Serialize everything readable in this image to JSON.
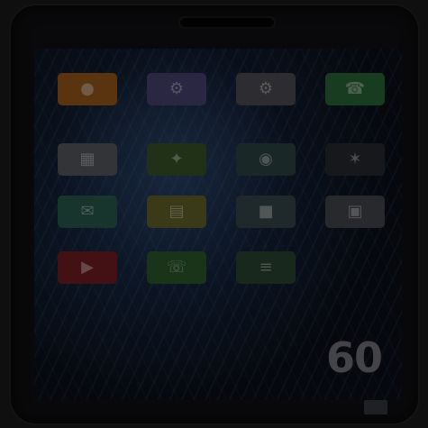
{
  "home_screen": {
    "apps": [
      {
        "row": 0,
        "col": 0,
        "label": "",
        "icon": "orange-circle-icon",
        "color": "#a4601c"
      },
      {
        "row": 0,
        "col": 1,
        "label": "",
        "icon": "settings-icon",
        "color": "#4c4778"
      },
      {
        "row": 0,
        "col": 2,
        "label": "",
        "icon": "gear-icon",
        "color": "#52525a"
      },
      {
        "row": 0,
        "col": 3,
        "label": "",
        "icon": "phone-icon",
        "color": "#2c6e3a"
      },
      {
        "row": 1,
        "col": 0,
        "label": "",
        "icon": "calendar-icon",
        "color": "#5c5f66"
      },
      {
        "row": 1,
        "col": 1,
        "label": "",
        "icon": "maps-icon",
        "color": "#3b5a2b"
      },
      {
        "row": 1,
        "col": 2,
        "label": "",
        "icon": "camera-icon",
        "color": "#2f4a45"
      },
      {
        "row": 1,
        "col": 3,
        "label": "",
        "icon": "network-icon",
        "color": "#2a2d33"
      },
      {
        "row": 2,
        "col": 0,
        "label": "",
        "icon": "messages-icon",
        "color": "#2b6152"
      },
      {
        "row": 2,
        "col": 1,
        "label": "",
        "icon": "notes-icon",
        "color": "#6b6a2e"
      },
      {
        "row": 2,
        "col": 2,
        "label": "",
        "icon": "widget-icon",
        "color": "#3a4a4e"
      },
      {
        "row": 2,
        "col": 3,
        "label": "",
        "icon": "store-icon",
        "color": "#4a4b52"
      },
      {
        "row": 3,
        "col": 0,
        "label": "",
        "icon": "youtube-icon",
        "color": "#7a1f24"
      },
      {
        "row": 3,
        "col": 1,
        "label": "",
        "icon": "whatsapp-icon",
        "color": "#2f5f2f"
      },
      {
        "row": 3,
        "col": 2,
        "label": "",
        "icon": "spotify-icon",
        "color": "#2c4a34"
      }
    ],
    "clock": {
      "time": "60",
      "prefix": "",
      "date": ""
    },
    "status_text": ""
  },
  "colors": {
    "background": "#1c1c1e",
    "bezel": "#111114",
    "text_dim": "#7d7d86"
  }
}
